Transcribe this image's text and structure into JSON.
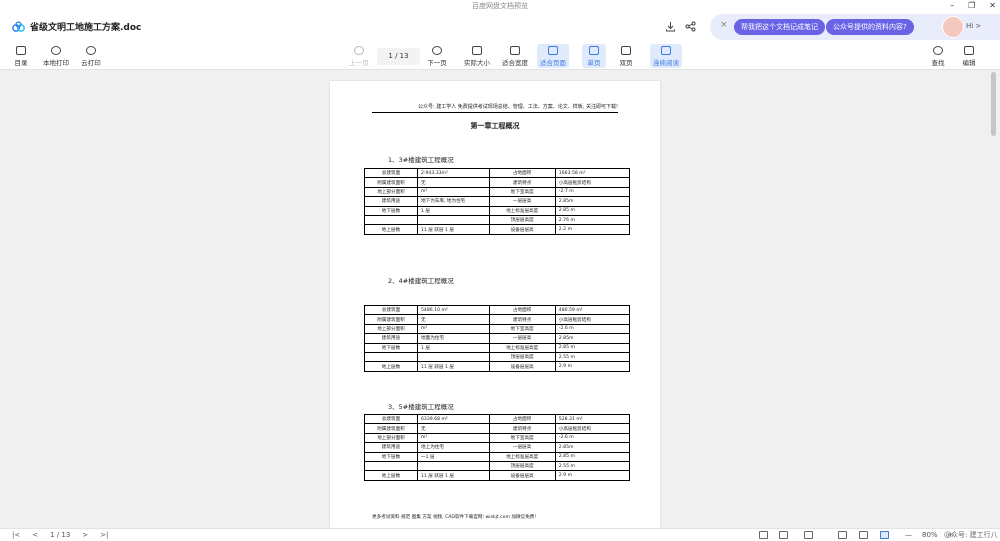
{
  "window": {
    "title": "百度网盘文档预览",
    "controls": [
      "–",
      "❐",
      "✕"
    ]
  },
  "doc": {
    "name": "省级文明工地施工方案.doc"
  },
  "header_icons": [
    "download-icon",
    "share-icon"
  ],
  "ai": {
    "close": "×",
    "chip1": "帮我把这个文档记成笔记",
    "chip2": "公众号提供的资料内容?",
    "greeting": "Hi >"
  },
  "toolbar": {
    "catalog": "目录",
    "local_print": "本地打印",
    "cloud_print": "云打印",
    "prev": "上一页",
    "page_indicator": "1 / 13",
    "next": "下一页",
    "actual_size": "实际大小",
    "fit_width": "适合宽度",
    "fit_page": "适合页面",
    "single": "单页",
    "double": "双页",
    "continuous": "连续阅读",
    "search": "查找",
    "edit": "编辑"
  },
  "page": {
    "header_line": "公众号: 建工学人 免费提供考试现场总结、管理、工法、方案、论文、样板, 关注即可下载!",
    "title": "第一章工程概况",
    "sections": [
      {
        "heading": "1、3#楼建筑工程概况",
        "rows": [
          [
            "总建筑面",
            "2:943.33m²",
            "占地面积",
            "1663.58 m²"
          ],
          [
            "附属建筑面积",
            "无",
            "建筑特点",
            "小高层框剪结构"
          ],
          [
            "地上部分面积",
            "m²",
            "地下室高度",
            "-2.7 m"
          ],
          [
            "建筑用途",
            "地下为车库, 地为住宅",
            "一层层高",
            "2.85m"
          ],
          [
            "地下层数",
            "1 层",
            "地上标准层高度",
            "2.85 m"
          ],
          [
            "",
            "",
            "顶层层高度",
            "2.76 m"
          ],
          [
            "地上层数",
            "11 层 跃层 1 层",
            "设备层层高",
            "2.2 m"
          ]
        ]
      },
      {
        "heading": "2、4#楼建筑工程概况",
        "rows": [
          [
            "总建筑面",
            "5486.10 m²",
            "占地面积",
            "480.59 m²"
          ],
          [
            "附属建筑面积",
            "无",
            "建筑特点",
            "小高层框剪结构"
          ],
          [
            "地上部分面积",
            "m²",
            "地下室高度",
            "-2.6 m"
          ],
          [
            "建筑用途",
            "地面为住宅",
            "一层层高",
            "2.85m"
          ],
          [
            "地下层数",
            "1 层",
            "地上标准层高度",
            "2.85 m"
          ],
          [
            "",
            "",
            "顶层层高度",
            "2.55 m"
          ],
          [
            "地上层数",
            "11 层 跃层 1 层",
            "设备层层高",
            "2.9 m"
          ]
        ]
      },
      {
        "heading": "3、5#楼建筑工程概况",
        "rows": [
          [
            "总建筑面",
            "6339.68 m²",
            "占地面积",
            "528.31 m²"
          ],
          [
            "附属建筑面积",
            "无",
            "建筑特点",
            "小高层框剪结构"
          ],
          [
            "地上部分面积",
            "m²",
            "地下室高度",
            "-2.6 m"
          ],
          [
            "建筑用途",
            "地上为住宅",
            "一层层高",
            "2.85m"
          ],
          [
            "地下层数",
            "一1 层",
            "地上标准层高度",
            "2.85 m"
          ],
          [
            "",
            "",
            "顶层层高度",
            "2.55 m"
          ],
          [
            "地上层数",
            "11 层 跃层 1 层",
            "设备层层高",
            "2.9 m"
          ]
        ]
      }
    ],
    "footer_line": "更多考试资料 规范 图集 方案 视频, CAD软件下载官网: wiskjt.com 加微信免费!"
  },
  "status": {
    "first": "|<",
    "prev": "<",
    "page": "1 / 13",
    "next": ">",
    "last": ">|",
    "zoom_out": "—",
    "zoom": "80%",
    "zoom_in": "+"
  },
  "watermark": "@众号: 建工行八"
}
